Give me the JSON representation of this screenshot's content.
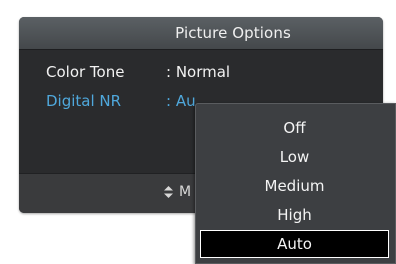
{
  "panel": {
    "title": "Picture Options"
  },
  "settings": [
    {
      "label": "Color Tone",
      "value": ": Normal"
    },
    {
      "label": "Digital NR",
      "value": ": Au"
    }
  ],
  "footer": {
    "hint_text": "M",
    "icon": "up-down-arrows-icon"
  },
  "dropdown": {
    "options": [
      "Off",
      "Low",
      "Medium",
      "High",
      "Auto"
    ],
    "selected": "Auto"
  },
  "colors": {
    "highlight_label": "#4fa8dc",
    "panel_bg": "#2b2c2e",
    "selected_bg": "#000000"
  }
}
